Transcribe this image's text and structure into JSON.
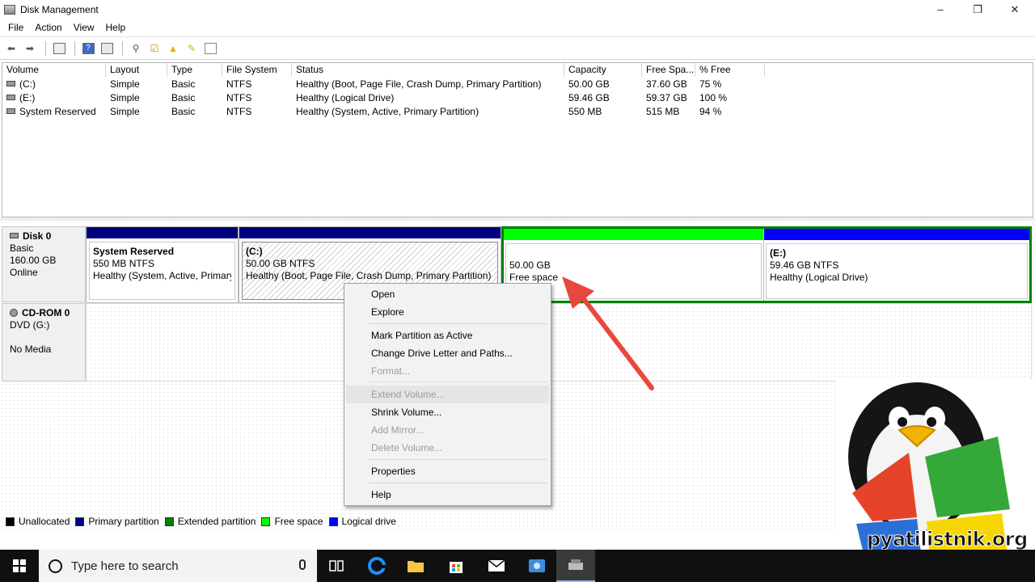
{
  "window": {
    "title": "Disk Management",
    "minimize": "–",
    "maximize": "❐",
    "close": "✕"
  },
  "menu": [
    "File",
    "Action",
    "View",
    "Help"
  ],
  "toolbar": {
    "items": [
      "back-icon",
      "forward-icon",
      "console-icon",
      "help-icon",
      "properties-icon",
      "connect-icon",
      "check-icon",
      "folder-up-icon",
      "folder-edit-icon",
      "settings-icon"
    ]
  },
  "volumes": {
    "columns": [
      "Volume",
      "Layout",
      "Type",
      "File System",
      "Status",
      "Capacity",
      "Free Spa...",
      "% Free"
    ],
    "rows": [
      {
        "volume": "(C:)",
        "layout": "Simple",
        "type": "Basic",
        "fs": "NTFS",
        "status": "Healthy (Boot, Page File, Crash Dump, Primary Partition)",
        "capacity": "50.00 GB",
        "free": "37.60 GB",
        "pct": "75 %"
      },
      {
        "volume": "(E:)",
        "layout": "Simple",
        "type": "Basic",
        "fs": "NTFS",
        "status": "Healthy (Logical Drive)",
        "capacity": "59.46 GB",
        "free": "59.37 GB",
        "pct": "100 %"
      },
      {
        "volume": "System Reserved",
        "layout": "Simple",
        "type": "Basic",
        "fs": "NTFS",
        "status": "Healthy (System, Active, Primary Partition)",
        "capacity": "550 MB",
        "free": "515 MB",
        "pct": "94 %"
      }
    ]
  },
  "disk0": {
    "name": "Disk 0",
    "type": "Basic",
    "size": "160.00 GB",
    "state": "Online",
    "partitions": [
      {
        "title": "System Reserved",
        "size": "550 MB NTFS",
        "status": "Healthy (System, Active, Primary"
      },
      {
        "title": "(C:)",
        "size": "50.00 GB NTFS",
        "status": "Healthy (Boot, Page File, Crash Dump, Primary Partition)"
      },
      {
        "title": "",
        "size": "50.00 GB",
        "status": "Free space"
      },
      {
        "title": "(E:)",
        "size": "59.46 GB NTFS",
        "status": "Healthy (Logical Drive)"
      }
    ]
  },
  "cdrom": {
    "name": "CD-ROM 0",
    "drive": "DVD (G:)",
    "media": "No Media"
  },
  "legend": [
    {
      "label": "Unallocated",
      "color": "#000000"
    },
    {
      "label": "Primary partition",
      "color": "#00007f"
    },
    {
      "label": "Extended partition",
      "color": "#008000"
    },
    {
      "label": "Free space",
      "color": "#00ff00"
    },
    {
      "label": "Logical drive",
      "color": "#0000ff"
    }
  ],
  "context_menu": {
    "open": "Open",
    "explore": "Explore",
    "mark_active": "Mark Partition as Active",
    "change_letter": "Change Drive Letter and Paths...",
    "format": "Format...",
    "extend": "Extend Volume...",
    "shrink": "Shrink Volume...",
    "add_mirror": "Add Mirror...",
    "delete": "Delete Volume...",
    "properties": "Properties",
    "help": "Help"
  },
  "taskbar": {
    "search_placeholder": "Type here to search"
  },
  "watermark": {
    "text": "pyatilistnik.org"
  },
  "colors": {
    "primary": "#00007f",
    "extended": "#008000",
    "free": "#00ff00",
    "logical": "#0000ff",
    "arrow": "#e8473f"
  }
}
